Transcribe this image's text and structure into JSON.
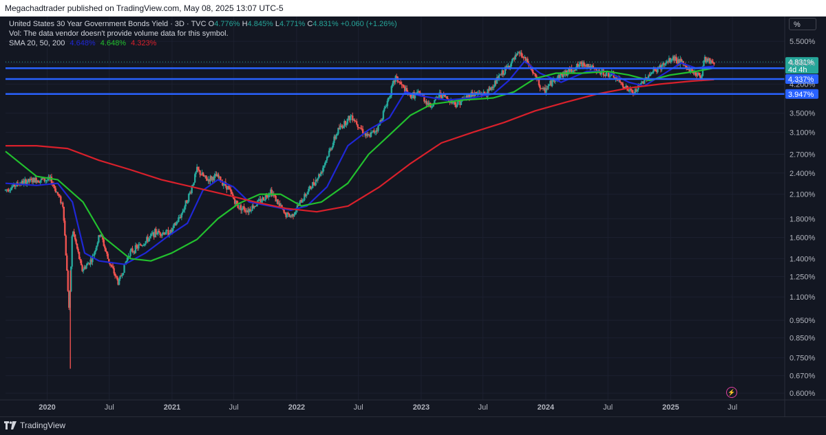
{
  "header": {
    "published_text": "Megachadtrader published on TradingView.com, May 08, 2025 13:07 UTC-5"
  },
  "legend": {
    "symbol_line": "United States 30 Year Government Bonds Yield · 3D · TVC",
    "open_label": "O",
    "open_value": "4.776%",
    "high_label": "H",
    "high_value": "4.845%",
    "low_label": "L",
    "low_value": "4.771%",
    "close_label": "C",
    "close_value": "4.831%",
    "change_value": "+0.060 (+1.26%)",
    "vol_text": "Vol: The data vendor doesn't provide volume data for this symbol.",
    "sma_label": "SMA 20, 50, 200",
    "sma20_value": "4.648%",
    "sma50_value": "4.648%",
    "sma200_value": "4.323%",
    "colors": {
      "sma20": "#1f27d6",
      "sma50": "#22c02e",
      "sma200": "#d9202b",
      "up": "#26a69a",
      "down": "#ef5350"
    }
  },
  "toolbar": {
    "scale_button": "%"
  },
  "price_labels": {
    "current": "4.831%",
    "countdown": "4d 4h",
    "line1": "4.642%",
    "line2": "4.337%",
    "line3": "3.947%"
  },
  "footer": {
    "brand": "TradingView"
  },
  "chart_data": {
    "type": "candlestick",
    "title": "United States 30 Year Government Bonds Yield · 3D · TVC",
    "y_scale": "log",
    "y_ticks": [
      "5.500%",
      "4.800%",
      "4.200%",
      "3.500%",
      "3.100%",
      "2.700%",
      "2.400%",
      "2.100%",
      "1.800%",
      "1.600%",
      "1.400%",
      "1.250%",
      "1.100%",
      "0.950%",
      "0.850%",
      "0.750%",
      "0.670%",
      "0.600%"
    ],
    "x_ticks": [
      "2020",
      "Jul",
      "2021",
      "Jul",
      "2022",
      "Jul",
      "2023",
      "Jul",
      "2024",
      "Jul",
      "2025",
      "Jul"
    ],
    "x_range": [
      "2019-09-01",
      "2025-12-01"
    ],
    "y_range": [
      0.58,
      6.0
    ],
    "horizontal_lines": [
      4.642,
      4.337,
      3.947
    ],
    "last_close": 4.831,
    "price_path": [
      [
        "2019-09-01",
        2.15
      ],
      [
        "2019-10-15",
        2.25
      ],
      [
        "2019-12-01",
        2.3
      ],
      [
        "2020-01-15",
        2.3
      ],
      [
        "2020-02-20",
        1.95
      ],
      [
        "2020-03-09",
        0.99
      ],
      [
        "2020-03-18",
        1.7
      ],
      [
        "2020-04-15",
        1.3
      ],
      [
        "2020-05-15",
        1.4
      ],
      [
        "2020-06-08",
        1.65
      ],
      [
        "2020-06-30",
        1.4
      ],
      [
        "2020-07-31",
        1.2
      ],
      [
        "2020-08-31",
        1.45
      ],
      [
        "2020-10-15",
        1.55
      ],
      [
        "2020-11-15",
        1.65
      ],
      [
        "2020-12-31",
        1.65
      ],
      [
        "2021-01-31",
        1.85
      ],
      [
        "2021-02-28",
        2.15
      ],
      [
        "2021-03-18",
        2.45
      ],
      [
        "2021-04-15",
        2.3
      ],
      [
        "2021-05-15",
        2.35
      ],
      [
        "2021-06-15",
        2.2
      ],
      [
        "2021-07-15",
        1.95
      ],
      [
        "2021-08-15",
        1.9
      ],
      [
        "2021-09-30",
        2.05
      ],
      [
        "2021-10-20",
        2.15
      ],
      [
        "2021-11-30",
        1.85
      ],
      [
        "2021-12-20",
        1.83
      ],
      [
        "2022-01-31",
        2.1
      ],
      [
        "2022-03-15",
        2.4
      ],
      [
        "2022-05-06",
        3.15
      ],
      [
        "2022-06-14",
        3.45
      ],
      [
        "2022-07-31",
        3.0
      ],
      [
        "2022-08-31",
        3.2
      ],
      [
        "2022-10-21",
        4.38
      ],
      [
        "2022-11-30",
        3.9
      ],
      [
        "2022-12-31",
        3.95
      ],
      [
        "2023-01-31",
        3.65
      ],
      [
        "2023-03-01",
        3.95
      ],
      [
        "2023-04-15",
        3.7
      ],
      [
        "2023-05-31",
        3.95
      ],
      [
        "2023-07-15",
        3.95
      ],
      [
        "2023-08-21",
        4.4
      ],
      [
        "2023-10-19",
        5.11
      ],
      [
        "2023-11-15",
        4.75
      ],
      [
        "2023-12-27",
        4.0
      ],
      [
        "2024-01-31",
        4.35
      ],
      [
        "2024-04-25",
        4.8
      ],
      [
        "2024-05-31",
        4.55
      ],
      [
        "2024-07-15",
        4.45
      ],
      [
        "2024-09-16",
        3.95
      ],
      [
        "2024-10-31",
        4.45
      ],
      [
        "2025-01-14",
        4.96
      ],
      [
        "2025-02-28",
        4.6
      ],
      [
        "2025-04-04",
        4.4
      ],
      [
        "2025-04-11",
        4.95
      ],
      [
        "2025-05-08",
        4.83
      ]
    ],
    "series": [
      {
        "name": "SMA 20",
        "color": "#1f27d6",
        "values": [
          [
            "2019-09-01",
            2.25
          ],
          [
            "2019-12-01",
            2.22
          ],
          [
            "2020-02-01",
            2.25
          ],
          [
            "2020-03-15",
            2.0
          ],
          [
            "2020-04-20",
            1.45
          ],
          [
            "2020-06-01",
            1.38
          ],
          [
            "2020-08-15",
            1.35
          ],
          [
            "2020-10-15",
            1.45
          ],
          [
            "2020-12-15",
            1.6
          ],
          [
            "2021-02-15",
            1.75
          ],
          [
            "2021-04-01",
            2.15
          ],
          [
            "2021-05-15",
            2.3
          ],
          [
            "2021-06-30",
            2.2
          ],
          [
            "2021-08-15",
            2.0
          ],
          [
            "2021-10-15",
            1.95
          ],
          [
            "2021-12-15",
            1.9
          ],
          [
            "2022-01-31",
            1.95
          ],
          [
            "2022-03-31",
            2.2
          ],
          [
            "2022-05-31",
            2.85
          ],
          [
            "2022-07-31",
            3.15
          ],
          [
            "2022-09-30",
            3.4
          ],
          [
            "2022-11-15",
            4.0
          ],
          [
            "2022-12-31",
            3.9
          ],
          [
            "2023-03-15",
            3.8
          ],
          [
            "2023-05-31",
            3.85
          ],
          [
            "2023-07-31",
            3.95
          ],
          [
            "2023-09-15",
            4.3
          ],
          [
            "2023-10-31",
            4.85
          ],
          [
            "2023-12-15",
            4.5
          ],
          [
            "2024-02-15",
            4.25
          ],
          [
            "2024-04-30",
            4.55
          ],
          [
            "2024-06-30",
            4.55
          ],
          [
            "2024-08-31",
            4.25
          ],
          [
            "2024-10-15",
            4.15
          ],
          [
            "2024-12-15",
            4.5
          ],
          [
            "2025-01-31",
            4.8
          ],
          [
            "2025-03-15",
            4.65
          ],
          [
            "2025-05-08",
            4.7
          ]
        ]
      },
      {
        "name": "SMA 50",
        "color": "#22c02e",
        "values": [
          [
            "2019-09-01",
            2.75
          ],
          [
            "2019-12-01",
            2.35
          ],
          [
            "2020-02-01",
            2.3
          ],
          [
            "2020-04-15",
            2.0
          ],
          [
            "2020-06-15",
            1.6
          ],
          [
            "2020-08-31",
            1.4
          ],
          [
            "2020-10-31",
            1.38
          ],
          [
            "2020-12-31",
            1.45
          ],
          [
            "2021-03-15",
            1.58
          ],
          [
            "2021-05-15",
            1.8
          ],
          [
            "2021-07-15",
            1.98
          ],
          [
            "2021-09-15",
            2.1
          ],
          [
            "2021-11-15",
            2.1
          ],
          [
            "2022-01-15",
            1.95
          ],
          [
            "2022-03-15",
            2.0
          ],
          [
            "2022-05-31",
            2.25
          ],
          [
            "2022-07-31",
            2.7
          ],
          [
            "2022-09-30",
            3.05
          ],
          [
            "2022-11-30",
            3.45
          ],
          [
            "2023-01-31",
            3.7
          ],
          [
            "2023-04-30",
            3.8
          ],
          [
            "2023-07-31",
            3.85
          ],
          [
            "2023-09-30",
            4.0
          ],
          [
            "2023-11-30",
            4.35
          ],
          [
            "2024-01-31",
            4.5
          ],
          [
            "2024-04-15",
            4.5
          ],
          [
            "2024-06-30",
            4.55
          ],
          [
            "2024-08-31",
            4.45
          ],
          [
            "2024-10-31",
            4.3
          ],
          [
            "2024-12-31",
            4.45
          ],
          [
            "2025-03-15",
            4.55
          ],
          [
            "2025-05-08",
            4.648
          ]
        ]
      },
      {
        "name": "SMA 200",
        "color": "#d9202b",
        "values": [
          [
            "2019-09-01",
            2.85
          ],
          [
            "2019-12-01",
            2.85
          ],
          [
            "2020-03-01",
            2.8
          ],
          [
            "2020-06-01",
            2.6
          ],
          [
            "2020-09-01",
            2.45
          ],
          [
            "2020-12-01",
            2.3
          ],
          [
            "2021-03-01",
            2.2
          ],
          [
            "2021-06-01",
            2.1
          ],
          [
            "2021-09-01",
            2.0
          ],
          [
            "2021-12-01",
            1.92
          ],
          [
            "2022-03-01",
            1.88
          ],
          [
            "2022-06-01",
            1.95
          ],
          [
            "2022-09-01",
            2.2
          ],
          [
            "2022-12-01",
            2.55
          ],
          [
            "2023-03-01",
            2.9
          ],
          [
            "2023-06-01",
            3.1
          ],
          [
            "2023-09-01",
            3.3
          ],
          [
            "2023-12-01",
            3.55
          ],
          [
            "2024-03-01",
            3.75
          ],
          [
            "2024-06-01",
            3.95
          ],
          [
            "2024-09-01",
            4.1
          ],
          [
            "2024-12-01",
            4.2
          ],
          [
            "2025-03-01",
            4.28
          ],
          [
            "2025-05-08",
            4.323
          ]
        ]
      }
    ]
  }
}
